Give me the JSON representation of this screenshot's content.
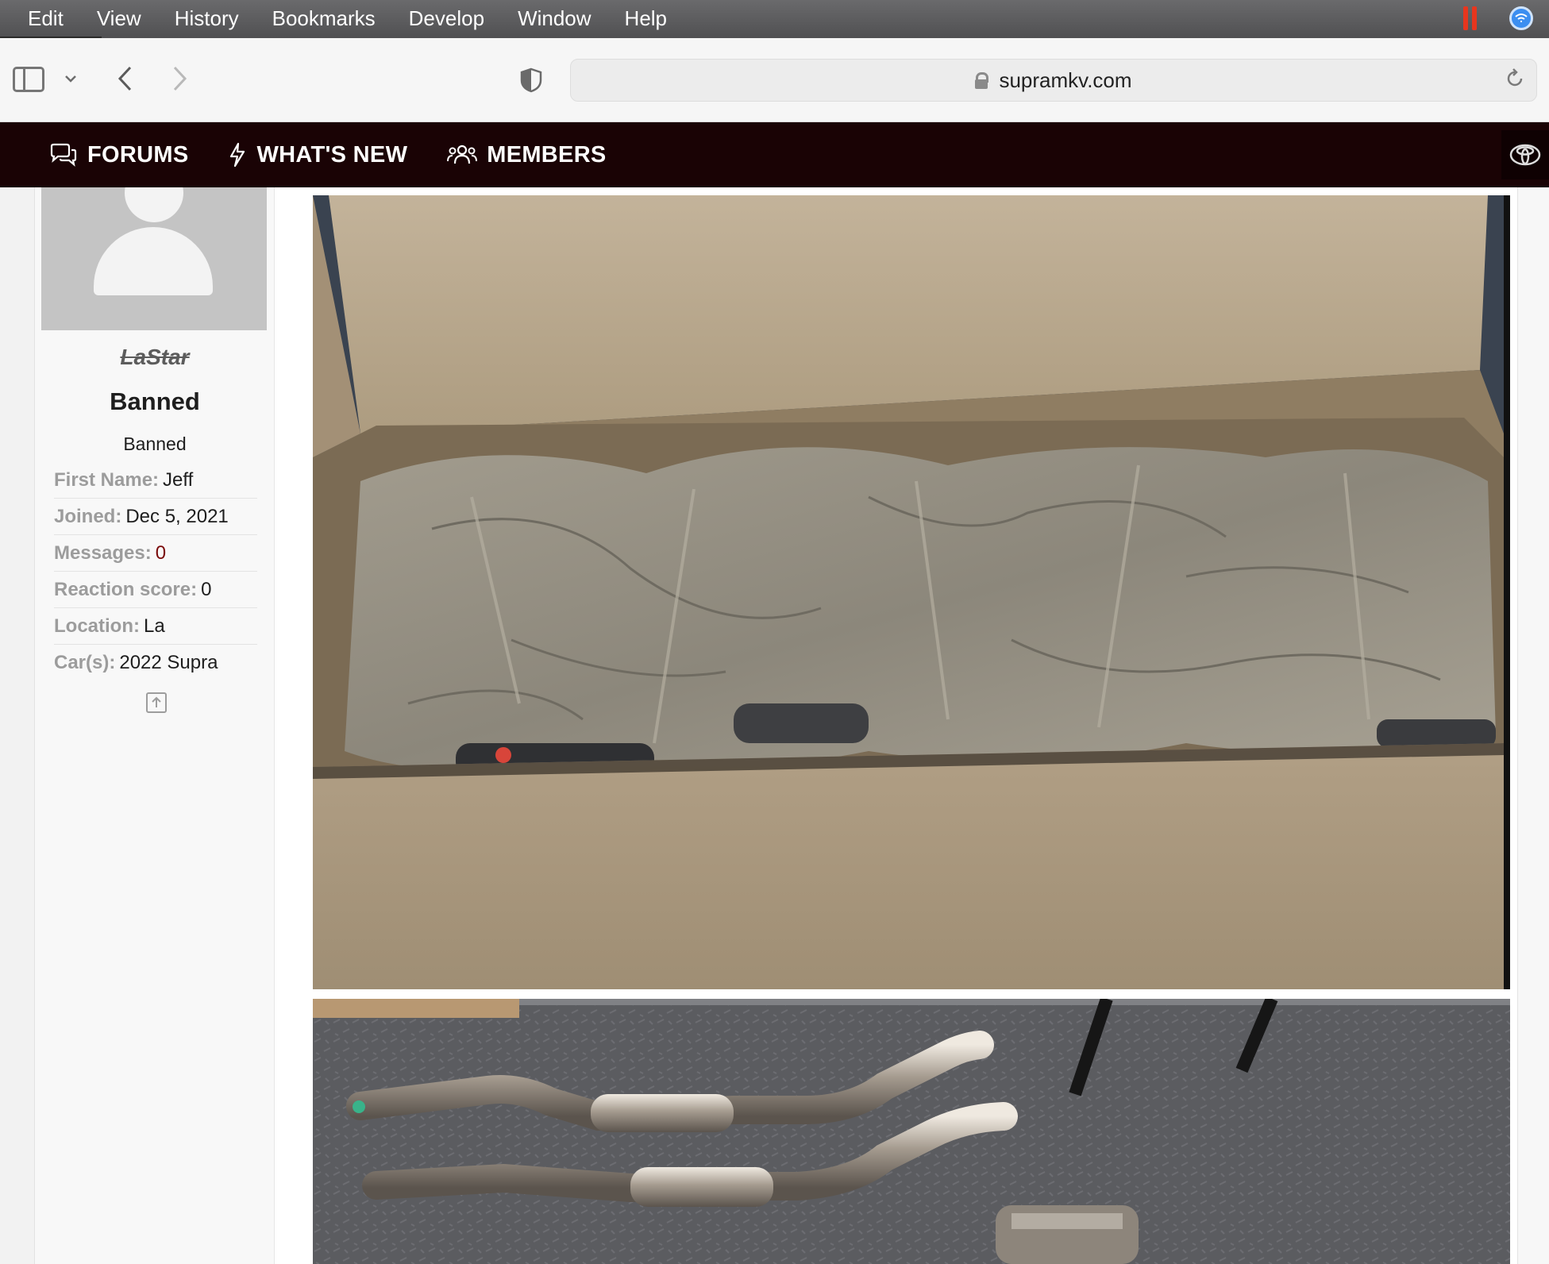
{
  "menubar": {
    "items": [
      "Edit",
      "View",
      "History",
      "Bookmarks",
      "Develop",
      "Window",
      "Help"
    ]
  },
  "toolbar": {
    "url": "supramkv.com"
  },
  "sitenav": {
    "items": [
      {
        "label": "FORUMS",
        "icon": "chat-bubbles-icon"
      },
      {
        "label": "WHAT'S NEW",
        "icon": "lightning-icon"
      },
      {
        "label": "MEMBERS",
        "icon": "users-icon"
      }
    ]
  },
  "user": {
    "name": "LaStar",
    "title": "Banned",
    "banner": "Banned",
    "info": [
      {
        "key": "First Name:",
        "value": "Jeff"
      },
      {
        "key": "Joined:",
        "value": "Dec 5, 2021"
      },
      {
        "key": "Messages:",
        "value": "0"
      },
      {
        "key": "Reaction score:",
        "value": "0"
      },
      {
        "key": "Location:",
        "value": "La"
      },
      {
        "key": "Car(s):",
        "value": "2022 Supra"
      }
    ]
  },
  "colors": {
    "nav_bg": "#1a0305",
    "messages_value": "#7a0a0a"
  },
  "photos": [
    {
      "subject": "cardboard box with exhaust wrapped in packing paper"
    },
    {
      "subject": "stainless steel exhaust pipes on rubber floor mat"
    }
  ]
}
